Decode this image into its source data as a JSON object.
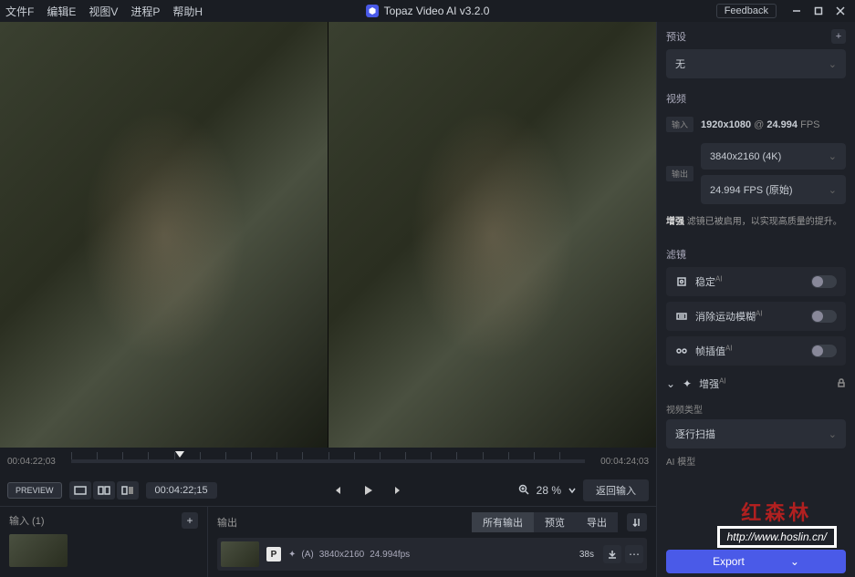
{
  "menu": [
    "文件F",
    "编辑E",
    "视图V",
    "进程P",
    "帮助H"
  ],
  "app_title": "Topaz Video AI  v3.2.0",
  "feedback": "Feedback",
  "timeline": {
    "tc_start": "00:04:22;03",
    "tc_end": "00:04:24;03",
    "preview_btn": "PREVIEW",
    "tc_current": "00:04:22;15",
    "zoom": "28 %",
    "return_btn": "返回输入"
  },
  "input_panel": {
    "title": "输入 (1)"
  },
  "output_panel": {
    "title": "输出",
    "tabs": [
      "所有输出",
      "预览",
      "导出"
    ],
    "row": {
      "p": "P",
      "ai": "(A)",
      "res": "3840x2160",
      "fps": "24.994fps",
      "dur": "38s"
    }
  },
  "sidebar": {
    "preset": {
      "label": "预设",
      "value": "无"
    },
    "video": {
      "label": "视频",
      "input_badge": "输入",
      "input_res": "1920x1080",
      "input_fps": "24.994",
      "fps_unit": "FPS",
      "output_badge": "输出",
      "output_res": "3840x2160 (4K)",
      "output_fps": "24.994 FPS (原始)",
      "note_bold": "增强",
      "note_text": " 滤镜已被启用，以实现高质量的提升。"
    },
    "filters": {
      "label": "滤镜",
      "stabilize": "稳定",
      "deblur": "消除运动模糊",
      "interp": "帧插值",
      "enhance": "增强"
    },
    "video_type": {
      "label": "视频类型",
      "value": "逐行扫描"
    },
    "ai_model": {
      "label": "AI 模型"
    },
    "export": "Export"
  },
  "watermark": {
    "title": "红森林",
    "url": "http://www.hoslin.cn/"
  }
}
